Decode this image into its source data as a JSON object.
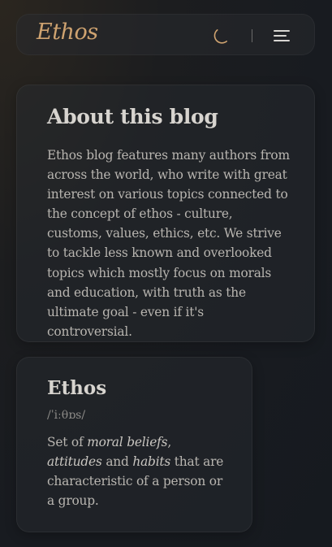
{
  "header": {
    "logo": "Ethos",
    "theme_toggle_icon": "moon-icon",
    "menu_icon": "hamburger-menu-icon"
  },
  "about": {
    "title": "About this blog",
    "text": "Ethos blog features many authors from across the world, who write with great interest on various topics connected to the concept of ethos - culture, customs, values, ethics, etc. We strive to tackle less known and overlooked topics which mostly focus on morals and education, with truth as the ultimate goal - even if it's controversial."
  },
  "definition": {
    "term": "Ethos",
    "phonetic": "/ˈiːθɒs/",
    "text_1": "Set of ",
    "em_1": "moral beliefs",
    "text_2": ", ",
    "em_2": "attitudes",
    "text_3": " and ",
    "em_3": "habits",
    "text_4": " that are characteristic of a person or a group."
  },
  "colors": {
    "accent": "#cfa370",
    "background": "#181b20",
    "card": "#282c30",
    "text": "#b8b5b0"
  }
}
